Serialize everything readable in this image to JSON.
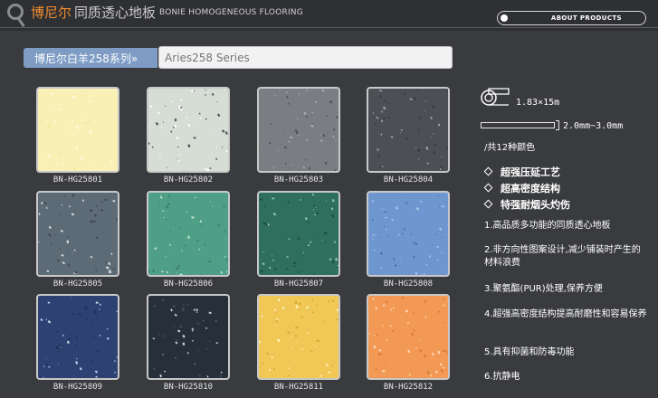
{
  "header": {
    "brand": "博尼尔",
    "brand_sub": "同质透心地板",
    "brand_en": "BONIE HOMOGENEOUS FLOORING",
    "about_button": "ABOUT PRODUCTS"
  },
  "series": {
    "tag": "博尼尔白羊258系列",
    "title": "Aries258 Series"
  },
  "tiles": [
    {
      "code": "BN-HG25801",
      "color": "#f8f0b4",
      "fleck": [
        "#f2e6a0",
        "#fffbe0"
      ]
    },
    {
      "code": "BN-HG25802",
      "color": "#d6ddd4",
      "fleck": [
        "#4d545a",
        "#ffffff"
      ]
    },
    {
      "code": "BN-HG25803",
      "color": "#7a7d82",
      "fleck": [
        "#a8adb4",
        "#4d5157"
      ]
    },
    {
      "code": "BN-HG25804",
      "color": "#4c4f53",
      "fleck": [
        "#383b3f",
        "#9aa0a6"
      ]
    },
    {
      "code": "BN-HG25805",
      "color": "#5d6b77",
      "fleck": [
        "#d7dde2",
        "#3c4650"
      ]
    },
    {
      "code": "BN-HG25806",
      "color": "#4f9e86",
      "fleck": [
        "#3b7b67",
        "#bde1d3"
      ]
    },
    {
      "code": "BN-HG25807",
      "color": "#2f6f5d",
      "fleck": [
        "#1f4f41",
        "#9dc9b9"
      ]
    },
    {
      "code": "BN-HG25808",
      "color": "#6f97cf",
      "fleck": [
        "#a9c4ea",
        "#4a6ea5"
      ]
    },
    {
      "code": "BN-HG25809",
      "color": "#2d4273",
      "fleck": [
        "#c9d4ec",
        "#1e2e55"
      ]
    },
    {
      "code": "BN-HG25810",
      "color": "#27303a",
      "fleck": [
        "#c8cdd2",
        "#3c4a58"
      ]
    },
    {
      "code": "BN-HG25811",
      "color": "#f1c755",
      "fleck": [
        "#fff3c4",
        "#d5a83c"
      ]
    },
    {
      "code": "BN-HG25812",
      "color": "#f29a55",
      "fleck": [
        "#ffd4ae",
        "#d8783b"
      ]
    }
  ],
  "specs": {
    "roll_size": "1.83×15m",
    "thickness": "2.0mm~3.0mm",
    "color_count": "/共12种颜色"
  },
  "features": [
    "超强压延工艺",
    "超高密度结构",
    "特强耐烟头灼伤"
  ],
  "points": [
    "1.高品质多功能的同质透心地板",
    "2.非方向性图案设计,减少铺装时产生的材料浪费",
    "3.聚氨酯(PUR)处理,保养方便",
    "4.超强高密度结构提高耐磨性和容易保养",
    "5.具有抑菌和防毒功能",
    "6.抗静电"
  ]
}
